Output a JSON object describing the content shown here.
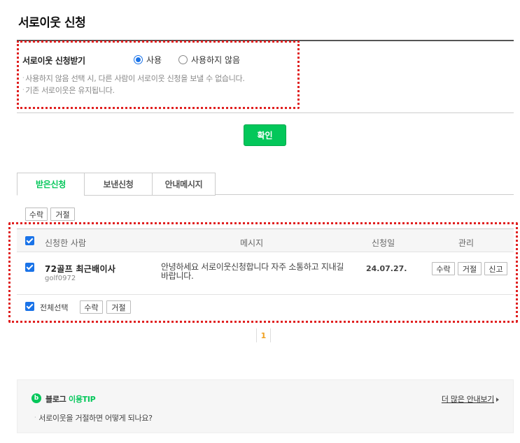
{
  "page": {
    "title": "서로이웃 신청"
  },
  "setting": {
    "label": "서로이웃 신청받기",
    "options": [
      {
        "label": "사용",
        "selected": true
      },
      {
        "label": "사용하지 않음",
        "selected": false
      }
    ],
    "notes": [
      "사용하지 않음 선택 시, 다른 사람이 서로이웃 신청을 보낼 수 없습니다.",
      "기존 서로이웃은 유지됩니다."
    ]
  },
  "confirm_label": "확인",
  "tabs": [
    {
      "label": "받은신청",
      "active": true
    },
    {
      "label": "보낸신청",
      "active": false
    },
    {
      "label": "안내메시지",
      "active": false
    }
  ],
  "top_actions": {
    "accept": "수락",
    "reject": "거절"
  },
  "table": {
    "headers": {
      "requester": "신청한 사람",
      "message": "메시지",
      "date": "신청일",
      "manage": "관리"
    },
    "rows": [
      {
        "name": "72골프 최근배이사",
        "id": "golf0972",
        "message": "안녕하세요 서로이웃신청합니다 자주 소통하고 지내길 바랍니다.",
        "date": "24.07.27.",
        "actions": {
          "accept": "수락",
          "reject": "거절",
          "report": "신고"
        }
      }
    ],
    "footer": {
      "select_all": "전체선택",
      "accept": "수락",
      "reject": "거절"
    }
  },
  "pagination": {
    "current": "1"
  },
  "tip": {
    "title_blog": "블로그",
    "title_rest": " 이용TIP",
    "more": "더 많은 안내보기",
    "question": "서로이웃을 거절하면 어떻게 되나요?"
  },
  "colors": {
    "accent_green": "#03c75a",
    "highlight_red": "#e02020",
    "checkbox_blue": "#1a73e8"
  }
}
